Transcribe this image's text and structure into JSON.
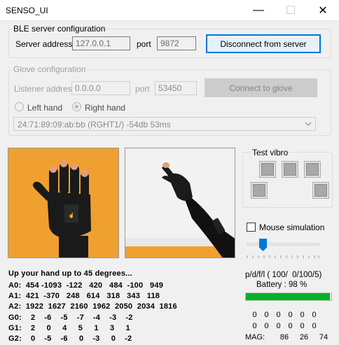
{
  "window": {
    "title": "SENSO_UI",
    "minimize_glyph": "—",
    "maximize_glyph": "☐",
    "close_glyph": "✕"
  },
  "ble": {
    "legend": "BLE server configuration",
    "address_label": "Server address",
    "address_value": "127.0.0.1",
    "port_label": "port",
    "port_value": "9872",
    "button_label": "Disconnect from server"
  },
  "glove": {
    "legend": "Glove configuration",
    "listener_label": "Listener address",
    "listener_value": "0.0.0.0",
    "port_label": "port",
    "port_value": "53450",
    "button_label": "Connect to glove",
    "left_hand_label": "Left hand",
    "right_hand_label": "Right hand",
    "selected_hand": "Right hand",
    "device_value": "24:71:89:09:ab:bb (RGHT1/) -54db 53ms"
  },
  "vibro": {
    "legend": "Test vibro",
    "mouse_sim_label": "Mouse simulation",
    "mouse_sim_checked": false
  },
  "status": {
    "pdfl": "p/d/f/l ( 100/  0/100/5)",
    "battery_text": "Battery : 98 %",
    "battery_level": 98,
    "battery_color": "#06b025"
  },
  "readout": {
    "instruction": "Up your hand up to 45 degrees...",
    "rows": [
      {
        "label": "A0:",
        "values": "454 -1093  -122   420   484  -100   949"
      },
      {
        "label": "A1:",
        "values": "421  -370   248   614   318   343   118"
      },
      {
        "label": "A2:",
        "values": "1922  1627  2160  1962  2050  2034  1816"
      },
      {
        "label": "G0:",
        "values": "2    -6    -5    -7    -4    -3    -2"
      },
      {
        "label": "G1:",
        "values": "2     0     4     5     1     3     1"
      },
      {
        "label": "G2:",
        "values": "0    -5    -6     0    -3     0    -2"
      }
    ],
    "zeros_row_1": [
      "0",
      "0",
      "0",
      "0",
      "0",
      "0"
    ],
    "zeros_row_2": [
      "0",
      "0",
      "0",
      "0",
      "0",
      "0"
    ],
    "mag_label": "MAG:",
    "mag_values": [
      "86",
      "26",
      "74"
    ]
  },
  "images": {
    "left_bg": "#f0a030",
    "right_bg": "#f2f2f2"
  }
}
